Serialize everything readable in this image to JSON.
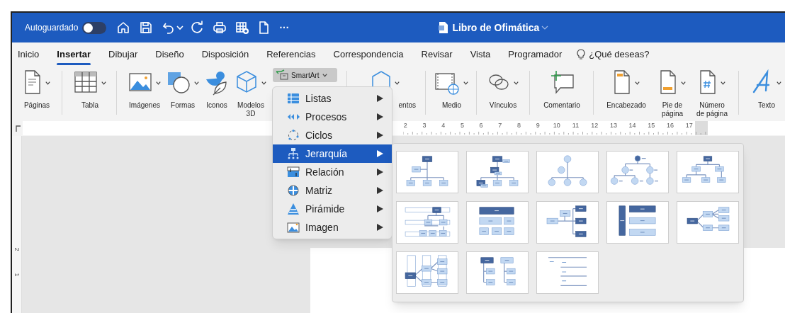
{
  "title_bar": {
    "autosave_label": "Autoguardado",
    "autosave_on": false,
    "more": "···",
    "title": "Libro de Ofimática"
  },
  "tabs": [
    {
      "label": "Inicio",
      "selected": false
    },
    {
      "label": "Insertar",
      "selected": true
    },
    {
      "label": "Dibujar",
      "selected": false
    },
    {
      "label": "Diseño",
      "selected": false
    },
    {
      "label": "Disposición",
      "selected": false
    },
    {
      "label": "Referencias",
      "selected": false
    },
    {
      "label": "Correspondencia",
      "selected": false
    },
    {
      "label": "Revisar",
      "selected": false
    },
    {
      "label": "Vista",
      "selected": false
    },
    {
      "label": "Programador",
      "selected": false
    }
  ],
  "tell_me": {
    "label": "¿Qué deseas?"
  },
  "ribbon": {
    "buttons": [
      {
        "kind": "large",
        "label": "Páginas",
        "dropdown": true
      },
      {
        "kind": "large",
        "label": "Tabla",
        "dropdown": true
      },
      {
        "kind": "large",
        "label": "Imágenes",
        "dropdown": true
      },
      {
        "kind": "large",
        "label": "Formas",
        "dropdown": true
      },
      {
        "kind": "large",
        "label": "Iconos",
        "dropdown": false
      },
      {
        "kind": "large",
        "label": "Modelos\n3D",
        "dropdown": true
      },
      {
        "kind": "small",
        "label": "SmartArt",
        "dropdown": true,
        "expanded": true
      },
      {
        "kind": "large",
        "label": "entos",
        "dropdown": true
      },
      {
        "kind": "large",
        "label": "Medio",
        "dropdown": true
      },
      {
        "kind": "large",
        "label": "Vínculos",
        "dropdown": true
      },
      {
        "kind": "large",
        "label": "Comentario",
        "dropdown": false
      },
      {
        "kind": "large",
        "label": "Encabezado",
        "dropdown": true
      },
      {
        "kind": "large",
        "label": "Pie de\npágina",
        "dropdown": true
      },
      {
        "kind": "large",
        "label": "Número\nde página",
        "dropdown": true
      },
      {
        "kind": "large",
        "label": "Texto",
        "dropdown": true
      }
    ]
  },
  "ruler": {
    "numbers": [
      "2",
      "3",
      "4",
      "5",
      "6",
      "7",
      "8",
      "9",
      "10",
      "11",
      "12",
      "13",
      "14",
      "15",
      "16",
      "17"
    ]
  },
  "vertical_ruler": {
    "numbers": [
      "2",
      "1"
    ]
  },
  "smartart_menu": {
    "items": [
      {
        "label": "Listas",
        "selected": false
      },
      {
        "label": "Procesos",
        "selected": false
      },
      {
        "label": "Ciclos",
        "selected": false
      },
      {
        "label": "Jerarquía",
        "selected": true
      },
      {
        "label": "Relación",
        "selected": false
      },
      {
        "label": "Matriz",
        "selected": false
      },
      {
        "label": "Pirámide",
        "selected": false
      },
      {
        "label": "Imagen",
        "selected": false
      }
    ]
  },
  "layout_gallery": {
    "items": [
      {
        "kind": "org",
        "selected": false
      },
      {
        "kind": "org-picture",
        "selected": false
      },
      {
        "kind": "circle-org",
        "selected": false
      },
      {
        "kind": "labeled-circles",
        "selected": false
      },
      {
        "kind": "name-org",
        "selected": false
      },
      {
        "kind": "labeled-hierarchy",
        "selected": false
      },
      {
        "kind": "table-hierarchy",
        "selected": false
      },
      {
        "kind": "horizontal-org",
        "selected": false
      },
      {
        "kind": "vertical-bar",
        "selected": false
      },
      {
        "kind": "horizontal-hierarchy",
        "selected": false
      },
      {
        "kind": "horizontal-labeled",
        "selected": false
      },
      {
        "kind": "hierarchy-list",
        "selected": false
      },
      {
        "kind": "lined-list",
        "selected": false
      }
    ]
  }
}
